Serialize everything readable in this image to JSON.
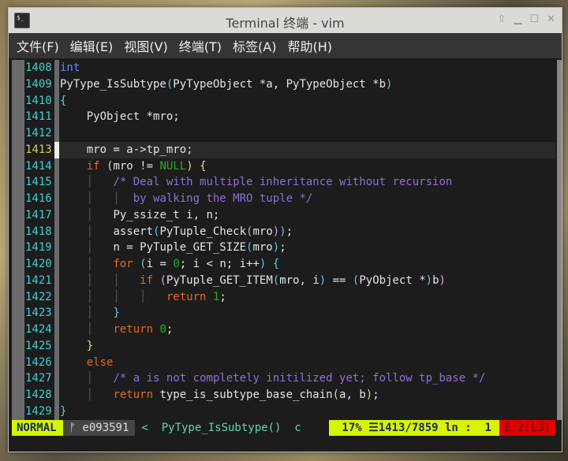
{
  "window": {
    "title": "Terminal 终端 - vim",
    "icon": "terminal-icon",
    "buttons": [
      "up-arrow-icon",
      "minimize-icon",
      "maximize-icon",
      "close-icon"
    ]
  },
  "menu": [
    "文件(F)",
    "编辑(E)",
    "视图(V)",
    "终端(T)",
    "标签(A)",
    "帮助(H)"
  ],
  "editor": {
    "current_line": "1413",
    "lines": [
      {
        "n": "1408",
        "t": [
          [
            "int",
            "ty"
          ]
        ]
      },
      {
        "n": "1409",
        "t": [
          [
            "PyType_IsSubtype",
            ""
          ],
          [
            "(",
            "p2"
          ],
          [
            "PyTypeObject *a, PyTypeObject *b",
            ""
          ],
          [
            ")",
            "p2"
          ]
        ]
      },
      {
        "n": "1410",
        "t": [
          [
            "{",
            "p2"
          ]
        ]
      },
      {
        "n": "1411",
        "t": [
          [
            "    PyObject *mro;",
            ""
          ]
        ]
      },
      {
        "n": "1412",
        "t": []
      },
      {
        "n": "1413",
        "t": [
          [
            "    mro = a->tp_mro;",
            ""
          ]
        ]
      },
      {
        "n": "1414",
        "t": [
          [
            "    ",
            ""
          ],
          [
            "if",
            "kw"
          ],
          [
            " ",
            ""
          ],
          [
            "(",
            "p1"
          ],
          [
            "mro != ",
            ""
          ],
          [
            "NULL",
            "nu"
          ],
          [
            ")",
            "p1"
          ],
          [
            " ",
            ""
          ],
          [
            "{",
            "p1"
          ]
        ]
      },
      {
        "n": "1415",
        "t": [
          [
            "    │   ",
            "gd"
          ],
          [
            "/* Deal with multiple inheritance without recursion",
            "cm"
          ]
        ]
      },
      {
        "n": "1416",
        "t": [
          [
            "    │   ",
            "gd"
          ],
          [
            "│  ",
            "gd"
          ],
          [
            "by walking the MRO tuple */",
            "cm"
          ]
        ]
      },
      {
        "n": "1417",
        "t": [
          [
            "    │   ",
            "gd"
          ],
          [
            "Py_ssize_t i, n;",
            ""
          ]
        ]
      },
      {
        "n": "1418",
        "t": [
          [
            "    │   ",
            "gd"
          ],
          [
            "assert",
            ""
          ],
          [
            "(",
            "p2"
          ],
          [
            "PyTuple_Check",
            ""
          ],
          [
            "(",
            "p3"
          ],
          [
            "mro",
            ""
          ],
          [
            ")",
            "p3"
          ],
          [
            ")",
            "p2"
          ],
          [
            ";",
            ""
          ]
        ]
      },
      {
        "n": "1419",
        "t": [
          [
            "    │   ",
            "gd"
          ],
          [
            "n = PyTuple_GET_SIZE",
            ""
          ],
          [
            "(",
            "p2"
          ],
          [
            "mro",
            ""
          ],
          [
            ")",
            "p2"
          ],
          [
            ";",
            ""
          ]
        ]
      },
      {
        "n": "1420",
        "t": [
          [
            "    │   ",
            "gd"
          ],
          [
            "for",
            "kw"
          ],
          [
            " ",
            ""
          ],
          [
            "(",
            "p2"
          ],
          [
            "i = ",
            ""
          ],
          [
            "0",
            "nu"
          ],
          [
            "; i < n; i++",
            ""
          ],
          [
            ")",
            "p2"
          ],
          [
            " ",
            ""
          ],
          [
            "{",
            "p2"
          ]
        ]
      },
      {
        "n": "1421",
        "t": [
          [
            "    │   ",
            "gd"
          ],
          [
            "│   ",
            "gd"
          ],
          [
            "if",
            "kw"
          ],
          [
            " ",
            ""
          ],
          [
            "(",
            "p3"
          ],
          [
            "PyTuple_GET_ITEM",
            ""
          ],
          [
            "(",
            "p2"
          ],
          [
            "mro, i",
            ""
          ],
          [
            ")",
            "p2"
          ],
          [
            " == ",
            ""
          ],
          [
            "(",
            "p2"
          ],
          [
            "PyObject *",
            ""
          ],
          [
            ")",
            "p2"
          ],
          [
            "b",
            ""
          ],
          [
            ")",
            "p3"
          ]
        ]
      },
      {
        "n": "1422",
        "t": [
          [
            "    │   ",
            "gd"
          ],
          [
            "│   ",
            "gd"
          ],
          [
            "│   ",
            "gd"
          ],
          [
            "return",
            "kw"
          ],
          [
            " ",
            ""
          ],
          [
            "1",
            "nu"
          ],
          [
            ";",
            ""
          ]
        ]
      },
      {
        "n": "1423",
        "t": [
          [
            "    │   ",
            "gd"
          ],
          [
            "}",
            "p2"
          ]
        ]
      },
      {
        "n": "1424",
        "t": [
          [
            "    │   ",
            "gd"
          ],
          [
            "return",
            "kw"
          ],
          [
            " ",
            ""
          ],
          [
            "0",
            "nu"
          ],
          [
            ";",
            ""
          ]
        ]
      },
      {
        "n": "1425",
        "t": [
          [
            "    ",
            ""
          ],
          [
            "}",
            "p1"
          ]
        ]
      },
      {
        "n": "1426",
        "t": [
          [
            "    ",
            ""
          ],
          [
            "else",
            "kw"
          ]
        ]
      },
      {
        "n": "1427",
        "t": [
          [
            "    │   ",
            "gd"
          ],
          [
            "/* a is not completely initilized yet; follow tp_base */",
            "cm"
          ]
        ]
      },
      {
        "n": "1428",
        "t": [
          [
            "    │   ",
            "gd"
          ],
          [
            "return",
            "kw"
          ],
          [
            " type_is_subtype_base_chain",
            ""
          ],
          [
            "(",
            "p1"
          ],
          [
            "a, b",
            ""
          ],
          [
            ")",
            "p1"
          ],
          [
            ";",
            ""
          ]
        ]
      },
      {
        "n": "1429",
        "t": [
          [
            "}",
            "p2"
          ]
        ]
      }
    ]
  },
  "status": {
    "mode": "NORMAL",
    "branch": "ᚠ e093591",
    "func": "<  PyType_IsSubtype()  c",
    "position": "17% ☰1413/7859 ln :  1",
    "errors": "E:2(L3)",
    "colors": {
      "mode_bg": "#d7f500",
      "error_bg": "#e00000"
    }
  }
}
